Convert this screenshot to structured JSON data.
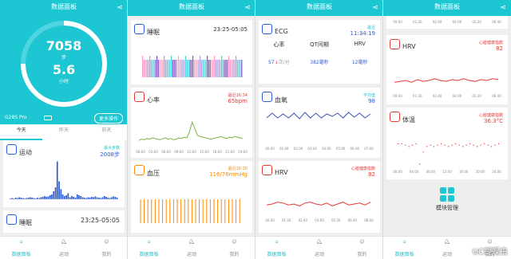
{
  "screens": {
    "s1": {
      "title": "数据面板",
      "steps": "7058",
      "steps_unit": "步",
      "hours": "5.6",
      "hours_unit": "小时",
      "device_name": "G28S Pro",
      "more_actions": "更多操作",
      "tabs": [
        "今天",
        "昨天",
        "前天"
      ],
      "sport_label": "运动",
      "sport_max_label": "最大步数",
      "sport_max_value": "2008步",
      "sleep_label": "睡眠",
      "sleep_time": "23:25-05:05",
      "sport_bars": [
        0.02,
        0.03,
        0.02,
        0.04,
        0.03,
        0.05,
        0.04,
        0.03,
        0.02,
        0.03,
        0.04,
        0.05,
        0.04,
        0.03,
        0.02,
        0.04,
        0.03,
        0.05,
        0.06,
        0.08,
        0.06,
        0.07,
        0.1,
        0.12,
        0.2,
        0.3,
        0.95,
        0.45,
        0.25,
        0.12,
        0.08,
        0.1,
        0.15,
        0.05,
        0.08,
        0.06,
        0.04,
        0.12,
        0.1,
        0.08,
        0.05,
        0.04,
        0.03,
        0.05,
        0.04,
        0.06,
        0.05,
        0.07,
        0.05,
        0.04,
        0.03,
        0.05,
        0.08,
        0.06,
        0.04,
        0.03,
        0.05,
        0.07,
        0.06,
        0.04
      ]
    },
    "s2": {
      "title": "数据面板",
      "sleep_label": "睡眠",
      "sleep_time": "23:25-05:05",
      "hr_label": "心率",
      "hr_latest_label": "最近16:34",
      "hr_value": "65bpm",
      "hr_ticks": [
        "00:00",
        "03:00",
        "06:00",
        "09:00",
        "12:00",
        "15:00",
        "18:00",
        "21:00",
        "24:00"
      ],
      "bp_label": "血压",
      "bp_latest_label": "最近16:30",
      "bp_value": "116/76mmHg",
      "hr_series": [
        42,
        44,
        43,
        45,
        44,
        46,
        45,
        44,
        43,
        45,
        46,
        44,
        45,
        43,
        44,
        46,
        45,
        47,
        46,
        55,
        70,
        60,
        50,
        48,
        47,
        46,
        45,
        44,
        45,
        46,
        47,
        48,
        46,
        45,
        47,
        46,
        48,
        47,
        46,
        45
      ]
    },
    "s3": {
      "title": "数据面板",
      "ecg_label": "ECG",
      "ecg_latest_label": "最近",
      "ecg_time": "11:34:19",
      "ecg_cols": [
        "心率",
        "QT间期",
        "HRV"
      ],
      "ecg_vals": [
        "57",
        "382毫秒",
        "12毫秒"
      ],
      "hr_unit": "次/分",
      "bo_label": "血氧",
      "bo_avg_label": "平均值",
      "bo_value": "98",
      "bo_ticks": [
        "00:00",
        "01:00",
        "02:00",
        "03:00",
        "04:00",
        "05:00",
        "06:00",
        "07:00"
      ],
      "hrv_label": "HRV",
      "hrv_index_label": "心脏健康指数",
      "hrv_value": "82",
      "hrv_ticks": [
        "00:00",
        "01:20",
        "02:40",
        "04:00",
        "05:20",
        "06:40",
        "08:00"
      ],
      "bo_series": [
        0.6,
        0.9,
        0.6,
        0.85,
        0.6,
        0.9,
        0.55,
        0.95,
        0.6,
        0.9,
        0.6,
        0.85,
        0.7,
        0.9,
        0.6,
        0.95,
        0.65,
        0.9,
        0.6,
        0.85
      ],
      "hrv_series": [
        0.45,
        0.5,
        0.6,
        0.55,
        0.45,
        0.5,
        0.4,
        0.55,
        0.6,
        0.5,
        0.45,
        0.55,
        0.4,
        0.5,
        0.6,
        0.45,
        0.5,
        0.55,
        0.45,
        0.6
      ]
    },
    "s4": {
      "title": "数据面板",
      "top_ticks": [
        "00:00",
        "01:20",
        "02:40",
        "04:00",
        "05:20",
        "06:40"
      ],
      "hrv_label": "HRV",
      "hrv_index_label": "心脏健康指数",
      "hrv_value": "82",
      "hrv_ticks": [
        "00:00",
        "01:20",
        "02:40",
        "04:00",
        "05:20",
        "06:40"
      ],
      "temp_label": "体温",
      "temp_index_label": "心脏健康指数",
      "temp_value": "36.3°C",
      "temp_ticks": [
        "00:00",
        "04:00",
        "08:00",
        "12:00",
        "16:00",
        "20:00",
        "24:00"
      ],
      "module_label": "模块管理",
      "hrv_series": [
        0.4,
        0.45,
        0.5,
        0.4,
        0.55,
        0.45,
        0.5,
        0.6,
        0.5,
        0.45,
        0.55,
        0.5,
        0.6,
        0.5,
        0.45,
        0.55,
        0.5,
        0.6,
        0.55
      ],
      "temp_series": [
        0.2,
        0.2,
        0.25,
        0.3,
        0.25,
        0.2,
        0.95,
        0.5,
        0.3,
        0.25,
        0.3,
        0.25,
        0.2,
        0.25,
        0.3,
        0.25,
        0.2,
        0.25,
        0.3,
        0.25,
        0.2,
        0.25,
        0.3,
        0.25,
        0.2,
        0.25,
        0.3,
        0.25,
        0.2
      ]
    }
  },
  "nav": [
    "数据面板",
    "运动",
    "我的"
  ],
  "colors": {
    "brand": "#1cc6d2",
    "accent_blue": "#2a5bd7",
    "warn_orange": "#ff8a00",
    "alert_red": "#e53935"
  },
  "watermark": "UC蝴蝶虫"
}
